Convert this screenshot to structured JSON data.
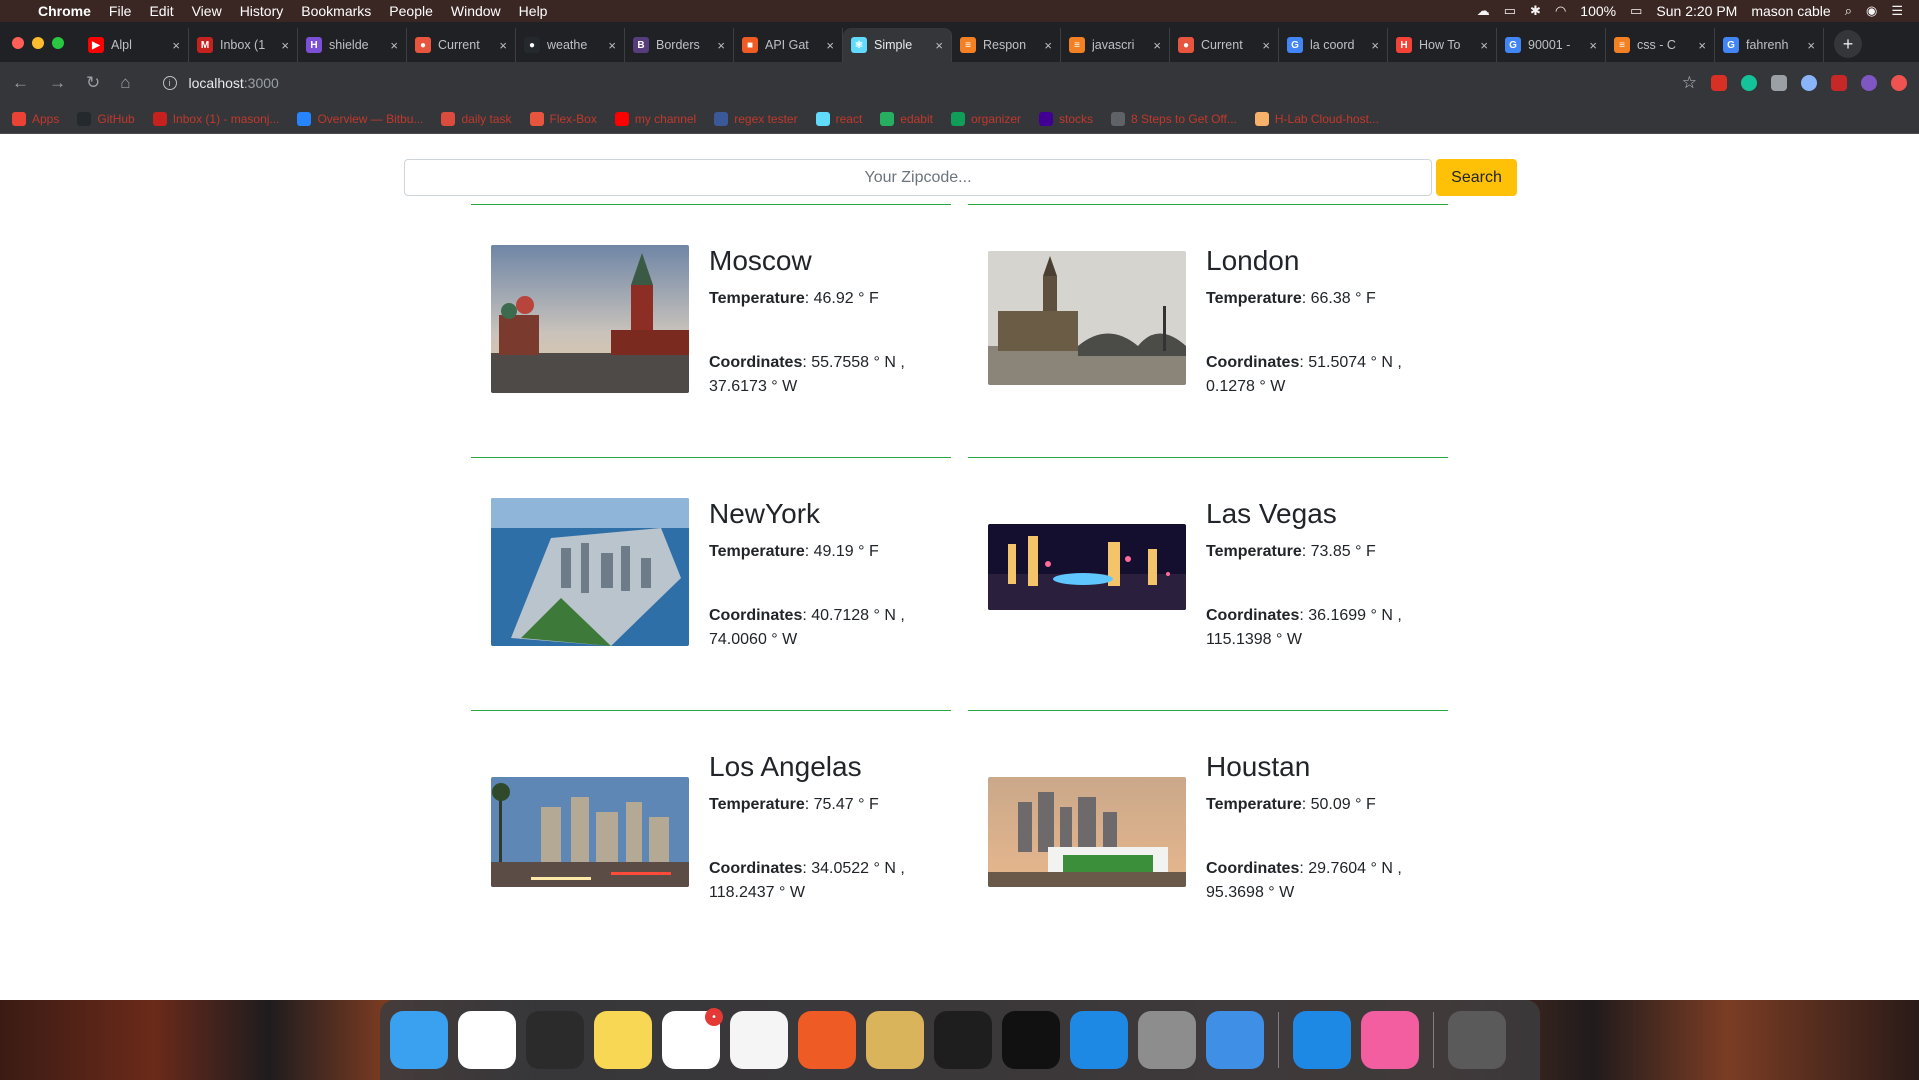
{
  "menubar": {
    "app": "Chrome",
    "items": [
      "File",
      "Edit",
      "View",
      "History",
      "Bookmarks",
      "People",
      "Window",
      "Help"
    ],
    "battery": "100%",
    "clock": "Sun 2:20 PM",
    "user": "mason cable"
  },
  "tabs": [
    {
      "title": "Alpl",
      "color": "#ff0000",
      "glyph": "▶"
    },
    {
      "title": "Inbox (1",
      "color": "#c5221f",
      "glyph": "M"
    },
    {
      "title": "shielde",
      "color": "#7b4fd6",
      "glyph": "H"
    },
    {
      "title": "Current",
      "color": "#e8553e",
      "glyph": "●"
    },
    {
      "title": "weathe",
      "color": "#24292e",
      "glyph": "●"
    },
    {
      "title": "Borders",
      "color": "#563d7c",
      "glyph": "B"
    },
    {
      "title": "API Gat",
      "color": "#ef5b25",
      "glyph": "■"
    },
    {
      "title": "Simple",
      "color": "#61dafb",
      "glyph": "⚛",
      "active": true
    },
    {
      "title": "Respon",
      "color": "#f48024",
      "glyph": "≡"
    },
    {
      "title": "javascri",
      "color": "#f48024",
      "glyph": "≡"
    },
    {
      "title": "Current",
      "color": "#e8553e",
      "glyph": "●"
    },
    {
      "title": "la coord",
      "color": "#4285f4",
      "glyph": "G"
    },
    {
      "title": "How To",
      "color": "#f44336",
      "glyph": "H"
    },
    {
      "title": "90001 -",
      "color": "#4285f4",
      "glyph": "G"
    },
    {
      "title": "css - C",
      "color": "#f48024",
      "glyph": "≡"
    },
    {
      "title": "fahrenh",
      "color": "#4285f4",
      "glyph": "G"
    }
  ],
  "address": {
    "host": "localhost",
    "port": ":3000"
  },
  "bookmarks": [
    {
      "label": "Apps",
      "color": "#ea4335"
    },
    {
      "label": "GitHub",
      "color": "#24292e"
    },
    {
      "label": "Inbox (1) - masonj...",
      "color": "#c5221f"
    },
    {
      "label": "Overview — Bitbu...",
      "color": "#2684ff"
    },
    {
      "label": "daily task",
      "color": "#db4c3f"
    },
    {
      "label": "Flex-Box",
      "color": "#e8553e"
    },
    {
      "label": "my channel",
      "color": "#ff0000"
    },
    {
      "label": "regex tester",
      "color": "#3b5998"
    },
    {
      "label": "react",
      "color": "#61dafb"
    },
    {
      "label": "edabit",
      "color": "#27ae60"
    },
    {
      "label": "organizer",
      "color": "#0f9d58"
    },
    {
      "label": "stocks",
      "color": "#410093"
    },
    {
      "label": "8 Steps to Get Off...",
      "color": "#5f6368"
    },
    {
      "label": "H-Lab Cloud-host...",
      "color": "#f6b26b"
    }
  ],
  "search": {
    "placeholder": "Your Zipcode...",
    "button_label": "Search"
  },
  "labels": {
    "temperature": "Temperature",
    "coordinates": "Coordinates"
  },
  "cities": [
    {
      "name": "Moscow",
      "temperature": ": 46.92 ° F",
      "coordinates": ": 55.7558 ° N , 37.6173 ° W",
      "photo": "red-square-kremlin"
    },
    {
      "name": "London",
      "temperature": ": 66.38 ° F",
      "coordinates": ": 51.5074 ° N , 0.1278 ° W",
      "photo": "big-ben-westminster"
    },
    {
      "name": "NewYork",
      "temperature": ": 49.19 ° F",
      "coordinates": ": 40.7128 ° N , 74.0060 ° W",
      "photo": "manhattan-aerial"
    },
    {
      "name": "Las Vegas",
      "temperature": ": 73.85 ° F",
      "coordinates": ": 36.1699 ° N , 115.1398 ° W",
      "photo": "vegas-strip-night"
    },
    {
      "name": "Los Angelas",
      "temperature": ": 75.47 ° F",
      "coordinates": ": 34.0522 ° N , 118.2437 ° W",
      "photo": "la-downtown-freeway"
    },
    {
      "name": "Houstan",
      "temperature": ": 50.09 ° F",
      "coordinates": ": 29.7604 ° N , 95.3698 ° W",
      "photo": "houston-skyline-stadium"
    }
  ],
  "dock": [
    {
      "name": "finder-icon",
      "color": "#3aa0f0"
    },
    {
      "name": "chrome-icon",
      "color": "#ffffff"
    },
    {
      "name": "quicktime-icon",
      "color": "#2b2b2b"
    },
    {
      "name": "notes-icon",
      "color": "#f7d754"
    },
    {
      "name": "slack-icon",
      "color": "#ffffff",
      "badge": "•"
    },
    {
      "name": "news-icon",
      "color": "#f5f5f5"
    },
    {
      "name": "postman-icon",
      "color": "#ef5b25"
    },
    {
      "name": "sequel-pro-icon",
      "color": "#d9b45a"
    },
    {
      "name": "terminal-icon",
      "color": "#1e1e1e"
    },
    {
      "name": "terminal-2-icon",
      "color": "#111111"
    },
    {
      "name": "vscode-icon",
      "color": "#1e88e5"
    },
    {
      "name": "calculator-icon",
      "color": "#8d8d8d"
    },
    {
      "name": "xcode-icon",
      "color": "#3f8fe6"
    },
    {
      "name": "vscode-insiders-icon",
      "color": "#1e88e5"
    },
    {
      "name": "itunes-icon",
      "color": "#f35ea1"
    },
    {
      "name": "trash-icon",
      "color": "#5a5a5a"
    }
  ],
  "colors": {
    "accent": "#ffc107",
    "divider": "#28a745"
  }
}
